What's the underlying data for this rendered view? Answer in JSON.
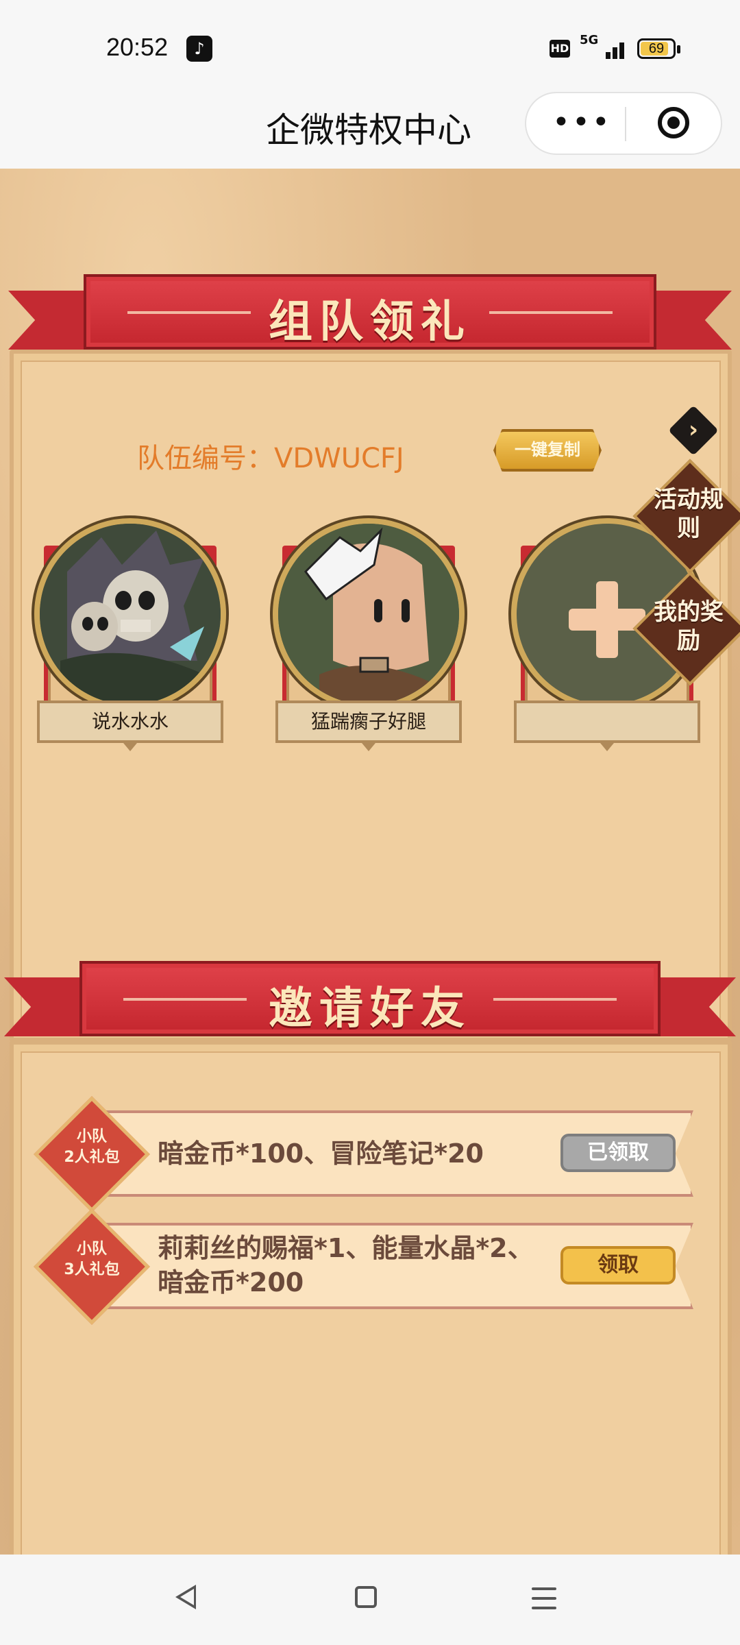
{
  "status_bar": {
    "time": "20:52",
    "network": "5G",
    "hd": "HD",
    "battery": "69"
  },
  "header": {
    "title": "企微特权中心",
    "more_icon": "more-dots-icon",
    "close_icon": "target-circle-icon"
  },
  "team_section": {
    "banner_title": "组队领礼",
    "team_number_label": "队伍编号：VDWUCFJ",
    "copy_button": "一键复制",
    "side_tags": {
      "rules": "活动规则",
      "rewards": "我的奖励"
    },
    "members": [
      {
        "name": "说水水水"
      },
      {
        "name": "猛踹瘸子好腿"
      },
      {
        "name": ""
      }
    ]
  },
  "invite_section": {
    "banner_title": "邀请好友",
    "rewards": [
      {
        "badge_line1": "小队",
        "badge_line2": "2人礼包",
        "desc_line1": "暗金币*100、冒险笔记*20",
        "desc_line2": "",
        "action": "已领取",
        "status": "claimed"
      },
      {
        "badge_line1": "小队",
        "badge_line2": "3人礼包",
        "desc_line1": "莉莉丝的赐福*1、能量水晶*2、",
        "desc_line2": "暗金币*200",
        "action": "领取",
        "status": "available"
      }
    ]
  },
  "colors": {
    "banner_red": "#c42a32",
    "team_number_orange": "#e37c2a",
    "claim_yellow": "#f3c14b",
    "claimed_gray": "#a8a8a8"
  }
}
